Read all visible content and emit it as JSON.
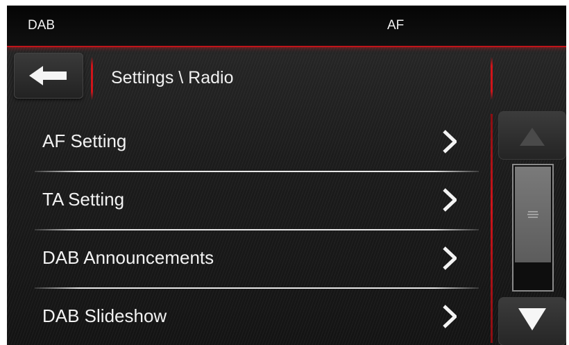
{
  "status_bar": {
    "left_label": "DAB",
    "center_label": "AF"
  },
  "header": {
    "breadcrumb": "Settings \\ Radio",
    "back_icon": "arrow-left-icon"
  },
  "menu": {
    "items": [
      {
        "label": "AF Setting"
      },
      {
        "label": "TA Setting"
      },
      {
        "label": "DAB Announcements"
      },
      {
        "label": "DAB Slideshow"
      }
    ],
    "chevron_icon": "chevron-right-icon"
  },
  "scrollbar": {
    "up_icon": "triangle-up-icon",
    "down_icon": "triangle-down-icon",
    "grip_icon": "grip-lines-icon",
    "position": 0.0
  },
  "colors": {
    "accent": "#d0141a",
    "text": "#f2f2f2",
    "background": "#1c1c1c"
  }
}
